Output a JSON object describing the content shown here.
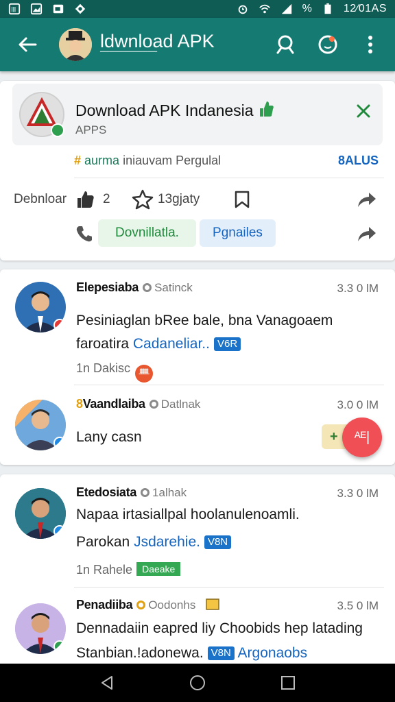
{
  "status_bar": {
    "battery": "%",
    "time": "12⁄01AS"
  },
  "app_bar": {
    "title": "ldwnload APK",
    "subtitle": "▔▔▔▔▔▔▔▔▔▔▔▔"
  },
  "app_card": {
    "name": "Download APK Indanesia",
    "category": "APPS",
    "meta_hash": "#",
    "meta_tag": "aurma",
    "meta_text": "iniauvam Pergulal",
    "meta_plus": "8ALUS",
    "actions_label": "Debnloar",
    "like_count": "2",
    "star_label": "13gjaty",
    "button_primary": "Dovnillatla.",
    "button_secondary": "Pgnailes"
  },
  "comments": [
    {
      "name": "Elepesiaba",
      "source": "Satinck",
      "time": "3.3 0 lM",
      "text_line1": "Pesiniaglan bRee bale, bna Vanagoaem",
      "text_line2_plain": "faroatira",
      "text_line2_link": "Cadaneliar..",
      "badge": "V6R",
      "footer": "1n Dakisc",
      "footer_icon": "ᚙ",
      "avatar_bg": "#2f6fb3",
      "badge_color": "#e53935"
    },
    {
      "name": "Vaandlaiba",
      "name_prefix": "8",
      "source": "Datlnak",
      "time": "3.0 0 lM",
      "text_line1": "Lany casn"
    },
    {
      "name": "Etedosiata",
      "source": "1alhak",
      "time": "3.3 0 lM",
      "text_line1": "Napaa irtasiallpal hoolanulenoamli.",
      "text_line2_plain": "Parokan",
      "text_line2_link": "Jsdarehie.",
      "badge": "V8N",
      "footer": "1n Rahele",
      "footer_chip": "Daeake"
    },
    {
      "name": "Penadiiba",
      "source": "Oodonhs",
      "time": "3.5 0 lM",
      "text_line1": "Dennadaiin eapred liy Choobids hep latading",
      "text_line2_plain": "Stanbian.!adonewa.",
      "badge": "V8N",
      "text_line2_link": "Argonaobs"
    }
  ],
  "fab": {
    "chip": "+",
    "label": "ᴬᴱ|"
  },
  "colors": {
    "app_bar": "#157a72",
    "status_bar": "#0f5c55",
    "accent_green": "#1f8a3b",
    "link_blue": "#1565c0",
    "fab_red": "#ef4f55"
  }
}
